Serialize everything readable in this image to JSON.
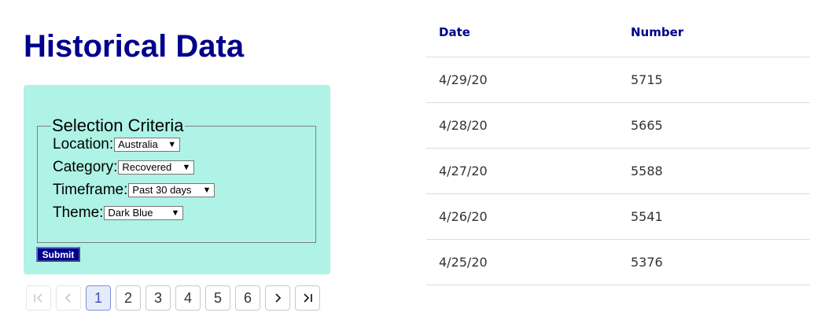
{
  "page": {
    "title": "Historical Data"
  },
  "criteria": {
    "legend": "Selection Criteria",
    "location_label": "Location:",
    "location_value": "Australia",
    "category_label": "Category:",
    "category_value": "Recovered",
    "timeframe_label": "Timeframe:",
    "timeframe_value": "Past 30 days",
    "theme_label": "Theme:",
    "theme_value": "Dark Blue",
    "submit_label": "Submit"
  },
  "pagination": {
    "pages": [
      "1",
      "2",
      "3",
      "4",
      "5",
      "6"
    ],
    "current_page": "1"
  },
  "table": {
    "headers": {
      "date": "Date",
      "number": "Number"
    },
    "rows": [
      {
        "date": "4/29/20",
        "number": "5715"
      },
      {
        "date": "4/28/20",
        "number": "5665"
      },
      {
        "date": "4/27/20",
        "number": "5588"
      },
      {
        "date": "4/26/20",
        "number": "5541"
      },
      {
        "date": "4/25/20",
        "number": "5376"
      }
    ]
  },
  "colors": {
    "title": "#00008b",
    "panel_background": "#aef3e5",
    "submit_background": "#00008b",
    "active_page_background": "#e6ebfa"
  },
  "icons": {
    "first": "first-page-icon",
    "prev": "chevron-left-icon",
    "next": "chevron-right-icon",
    "last": "last-page-icon",
    "dropdown": "dropdown-arrow-icon"
  }
}
